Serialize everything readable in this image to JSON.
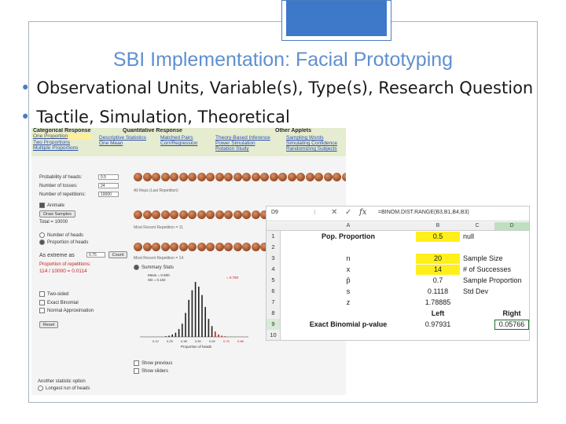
{
  "slide": {
    "title": "SBI Implementation: Facial Prototyping",
    "bullets": [
      "Observational Units, Variable(s), Type(s), Research Question",
      "Tactile, Simulation, Theoretical"
    ],
    "accent_color": "#4a7cc2"
  },
  "applet": {
    "menu": [
      {
        "header": "Categorical Response",
        "items": [
          "One Proportion",
          "Two Proportions",
          "Multiple Proportions"
        ]
      },
      {
        "header": "Quantitative Response",
        "items": [
          "Descriptive Statistics",
          "One Mean",
          "Matched Pairs",
          "Corr/Regression"
        ]
      },
      {
        "header": "Other Applets",
        "items": [
          "Theory-Based Inference",
          "Power Simulation",
          "Rotation Study",
          "Sampling Words",
          "Simulating Confidence",
          "Randomizing Subjects"
        ]
      }
    ],
    "inputs": {
      "prob_heads_label": "Probability of heads:",
      "prob_heads": "0.5",
      "tosses_label": "Number of tosses:",
      "tosses": "24",
      "reps_label": "Number of repetitions:",
      "reps": "10000"
    },
    "animate_label": "Animate",
    "draw_button": "Draw Samples",
    "total_label": "Total = 10000",
    "radio_heads": "Number of heads",
    "radio_prop": "Proportion of heads",
    "as_extreme_label": "As extreme as",
    "as_extreme_value": "0.75",
    "count_button": "Count",
    "prop_reps_label": "Proportion of repetitions:",
    "prop_reps_value": "114 / 10000 = 0.0114",
    "options": [
      "Two-sided",
      "Exact Binomial",
      "Normal Approximation"
    ],
    "reset_button": "Reset",
    "captions": {
      "all_reps": "All Reps (Last Repetition)",
      "most_recent": "Most Recent Repetition = 11",
      "second": "Most Recent Repetition = 14"
    },
    "summary_stats_label": "Summary Stats",
    "mean_sd": [
      "Mean = 0.500",
      "SD = 0.102"
    ],
    "hist_xticks": [
      "0.12",
      "0.25",
      "0.38",
      "0.50",
      "0.62",
      "0.75",
      "0.88"
    ],
    "hist_xlabel": "Proportion of heads",
    "hist_red_note": "= 0.750",
    "hist_bars": [
      1,
      2,
      4,
      7,
      13,
      22,
      40,
      62,
      78,
      92,
      84,
      70,
      50,
      30,
      18,
      9,
      4,
      2,
      1
    ],
    "show_previous": "Show previous",
    "show_sliders": "Show sliders",
    "another_option": "Another statistic option",
    "longest_run": "Longest run of heads"
  },
  "spreadsheet": {
    "name_box": "D9",
    "formula": "=BINOM.DIST.RANGE(B3,B1,B4,B3)",
    "columns": [
      "A",
      "B",
      "C",
      "D"
    ],
    "row_numbers": [
      "1",
      "2",
      "3",
      "4",
      "5",
      "6",
      "7",
      "8",
      "9",
      "10"
    ],
    "rows": [
      {
        "a": "Pop. Proportion",
        "b": "0.5",
        "c": "null",
        "d": ""
      },
      {
        "a": "",
        "b": "",
        "c": "",
        "d": ""
      },
      {
        "a": "n",
        "b": "20",
        "c": "Sample Size",
        "d": ""
      },
      {
        "a": "x",
        "b": "14",
        "c": "# of Successes",
        "d": ""
      },
      {
        "a": "p̂",
        "b": "0.7",
        "c": "Sample Proportion",
        "d": ""
      },
      {
        "a": "s",
        "b": "0.1118",
        "c": "Std Dev",
        "d": ""
      },
      {
        "a": "z",
        "b": "1.78885",
        "c": "",
        "d": ""
      },
      {
        "a": "",
        "b": "Left",
        "c": "",
        "d": "Right"
      },
      {
        "a": "Exact Binomial p-value",
        "b": "0.97931",
        "c": "",
        "d": "0.05766"
      },
      {
        "a": "",
        "b": "",
        "c": "",
        "d": ""
      }
    ],
    "highlight_color": "#ffef1a",
    "selected_col_color": "#bde0bd"
  }
}
